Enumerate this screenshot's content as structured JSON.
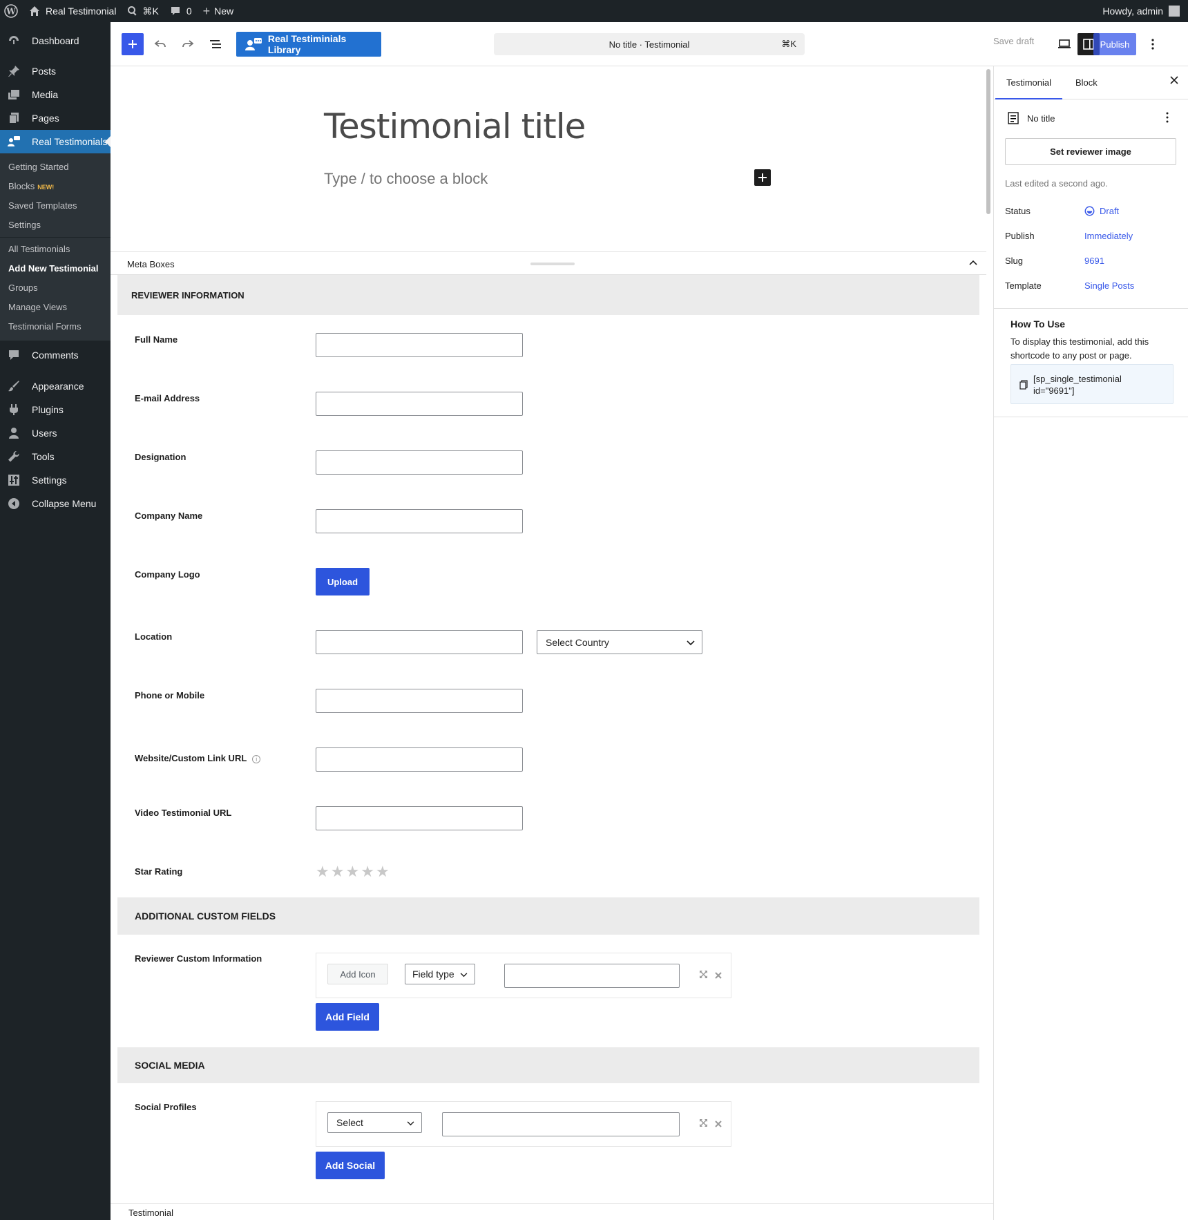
{
  "adminbar": {
    "site_name": "Real Testimonial",
    "search_shortcut": "⌘K",
    "comments_count": "0",
    "new_label": "New",
    "howdy": "Howdy, admin"
  },
  "menu": {
    "dashboard": "Dashboard",
    "posts": "Posts",
    "media": "Media",
    "pages": "Pages",
    "real_testimonials": "Real Testimonials",
    "sub_getting_started": "Getting Started",
    "sub_blocks": "Blocks",
    "sub_blocks_badge": "NEW!",
    "sub_saved_templates": "Saved Templates",
    "sub_settings": "Settings",
    "sub_all": "All Testimonials",
    "sub_add_new": "Add New Testimonial",
    "sub_groups": "Groups",
    "sub_manage_views": "Manage Views",
    "sub_forms": "Testimonial Forms",
    "comments": "Comments",
    "appearance": "Appearance",
    "plugins": "Plugins",
    "users": "Users",
    "tools": "Tools",
    "settings": "Settings",
    "collapse": "Collapse Menu"
  },
  "header": {
    "library_button": "Real Testiminials Library",
    "doc_title": "No title · Testimonial",
    "doc_shortcut": "⌘K",
    "save_draft": "Save draft",
    "publish": "Publish"
  },
  "canvas": {
    "title_placeholder": "Testimonial title",
    "block_hint": "Type / to choose a block"
  },
  "metabox": {
    "label": "Meta Boxes",
    "section_reviewer": "REVIEWER INFORMATION",
    "full_name": "Full Name",
    "email": "E-mail Address",
    "designation": "Designation",
    "company_name": "Company Name",
    "company_logo": "Company Logo",
    "upload": "Upload",
    "location": "Location",
    "select_country": "Select Country",
    "phone": "Phone or Mobile",
    "website": "Website/Custom Link URL",
    "video": "Video Testimonial URL",
    "star_rating": "Star Rating",
    "rating_value": 0,
    "rating_max": 5,
    "section_additional": "ADDITIONAL CUSTOM FIELDS",
    "reviewer_custom": "Reviewer Custom Information",
    "add_icon": "Add Icon",
    "field_type": "Field type",
    "add_field": "Add Field",
    "section_social": "SOCIAL MEDIA",
    "social_profiles": "Social Profiles",
    "social_select": "Select",
    "add_social": "Add Social"
  },
  "footer": {
    "breadcrumb": "Testimonial"
  },
  "sidebar": {
    "tab_testimonial": "Testimonial",
    "tab_block": "Block",
    "post_title": "No title",
    "set_reviewer_image": "Set reviewer image",
    "last_edited": "Last edited a second ago.",
    "status_label": "Status",
    "status_value": "Draft",
    "publish_label": "Publish",
    "publish_value": "Immediately",
    "slug_label": "Slug",
    "slug_value": "9691",
    "template_label": "Template",
    "template_value": "Single Posts",
    "how_to_title": "How To Use",
    "how_to_text": "To display this testimonial, add this shortcode to any post or page.",
    "shortcode_line1": "[sp_single_testimonial",
    "shortcode_line2": "id=\"9691\"]"
  },
  "colors": {
    "accent": "#3858e9",
    "admin_dark": "#1d2327",
    "menu_active": "#2271b1",
    "button_blue": "#2d55dd"
  }
}
